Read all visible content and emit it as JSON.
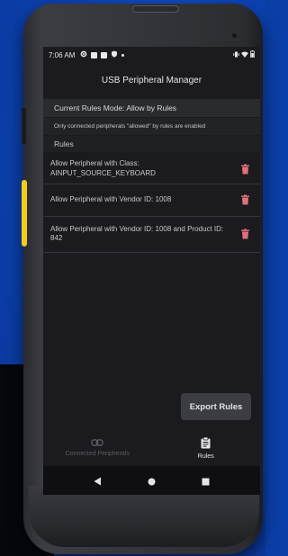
{
  "status_bar": {
    "time": "7:06 AM",
    "icons": [
      "gear-icon",
      "notification-icon",
      "square-icon",
      "shield-icon",
      "dot-icon"
    ],
    "right_icons": [
      "vibrate-icon",
      "wifi-icon",
      "battery-icon"
    ]
  },
  "app_bar": {
    "title": "USB Peripheral Manager"
  },
  "mode": {
    "label": "Current Rules Mode: Allow by Rules"
  },
  "note": {
    "text": "Only connected peripherals \"allowed\" by rules are enabled"
  },
  "rules_header": {
    "label": "Rules"
  },
  "rules": [
    {
      "text": "Allow Peripheral with Class: AINPUT_SOURCE_KEYBOARD"
    },
    {
      "text": "Allow Peripheral with Vendor ID: 1008"
    },
    {
      "text": "Allow Peripheral with Vendor ID: 1008 and Product ID: 842"
    }
  ],
  "export_button": {
    "label": "Export Rules"
  },
  "bottom_nav": {
    "items": [
      {
        "label": "Connected Peripherals",
        "icon": "link-icon",
        "active": false
      },
      {
        "label": "Rules",
        "icon": "clipboard-icon",
        "active": true
      }
    ]
  },
  "system_nav": [
    "back-icon",
    "home-icon",
    "recents-icon"
  ],
  "colors": {
    "background": "#0b3fa8",
    "screen": "#1b1b1f",
    "trash": "#e0707a",
    "button": "#3c3d42"
  }
}
